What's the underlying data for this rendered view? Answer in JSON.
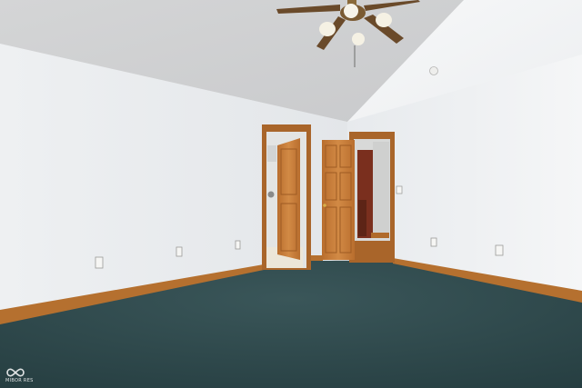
{
  "scene": {
    "description_kind": "photo",
    "colors": {
      "wall_left": "#e9ecef",
      "wall_right": "#f1f3f5",
      "ceiling": "#d9dadb",
      "carpet": "#2f4a4d",
      "trim": "#b7702e",
      "door_wood": "#c27a38",
      "door_frame": "#a9652a"
    }
  },
  "watermark": {
    "text": "MIBOR RES"
  }
}
